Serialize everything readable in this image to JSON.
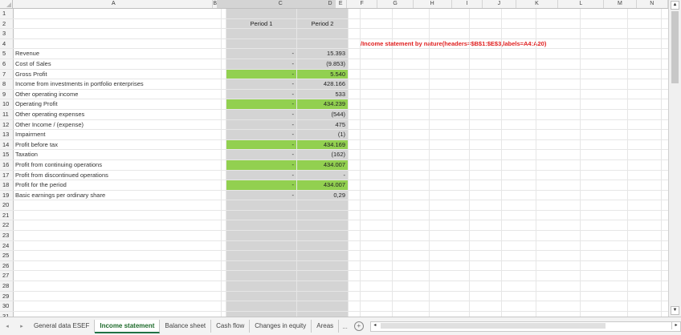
{
  "columns": [
    "A",
    "B",
    "C",
    "D",
    "E",
    "F",
    "G",
    "H",
    "I",
    "J",
    "K",
    "L",
    "M",
    "N"
  ],
  "header_row": {
    "c": "Period 1",
    "d": "Period 2"
  },
  "annotation": "/Income statement by nature(headers=$B$1:$E$3,labels=A4:A20)",
  "rows": [
    {
      "num": "1",
      "a": "",
      "c": "",
      "d": "",
      "green": false
    },
    {
      "num": "2",
      "a": "",
      "c": "Period 1",
      "d": "Period 2",
      "green": false
    },
    {
      "num": "3",
      "a": "",
      "c": "",
      "d": "",
      "green": false
    },
    {
      "num": "4",
      "a": "",
      "c": "",
      "d": "",
      "green": false
    },
    {
      "num": "5",
      "a": "Revenue",
      "c": "-",
      "d": "15.393",
      "green": false
    },
    {
      "num": "6",
      "a": "Cost of Sales",
      "c": "-",
      "d": "(9.853)",
      "green": false
    },
    {
      "num": "7",
      "a": "Gross Profit",
      "c": "-",
      "d": "5.540",
      "green": true
    },
    {
      "num": "8",
      "a": "Income from investments in portfolio enterprises",
      "c": "-",
      "d": "428.166",
      "green": false
    },
    {
      "num": "9",
      "a": "Other operating income",
      "c": "-",
      "d": "533",
      "green": false
    },
    {
      "num": "10",
      "a": "Operating Profit",
      "c": "-",
      "d": "434.239",
      "green": true
    },
    {
      "num": "11",
      "a": "Other operating expenses",
      "c": "-",
      "d": "(544)",
      "green": false
    },
    {
      "num": "12",
      "a": "Other Income / (expense)",
      "c": "-",
      "d": "475",
      "green": false
    },
    {
      "num": "13",
      "a": "Impairment",
      "c": "-",
      "d": "(1)",
      "green": false
    },
    {
      "num": "14",
      "a": "Profit before tax",
      "c": "-",
      "d": "434.169",
      "green": true
    },
    {
      "num": "15",
      "a": "Taxation",
      "c": "-",
      "d": "(162)",
      "green": false
    },
    {
      "num": "16",
      "a": "Profit from continuing operations",
      "c": "-",
      "d": "434.007",
      "green": true
    },
    {
      "num": "17",
      "a": "Profit from discontinued operations",
      "c": "-",
      "d": "-",
      "green": false
    },
    {
      "num": "18",
      "a": "Profit for the period",
      "c": "-",
      "d": "434.007",
      "green": true
    },
    {
      "num": "19",
      "a": "Basic earnings per ordinary share",
      "c": "-",
      "d": "0,29",
      "green": false
    },
    {
      "num": "20",
      "a": "",
      "c": "",
      "d": "",
      "green": false
    },
    {
      "num": "21",
      "a": "",
      "c": "",
      "d": "",
      "green": false
    },
    {
      "num": "22",
      "a": "",
      "c": "",
      "d": "",
      "green": false
    },
    {
      "num": "23",
      "a": "",
      "c": "",
      "d": "",
      "green": false
    },
    {
      "num": "24",
      "a": "",
      "c": "",
      "d": "",
      "green": false
    },
    {
      "num": "25",
      "a": "",
      "c": "",
      "d": "",
      "green": false
    },
    {
      "num": "26",
      "a": "",
      "c": "",
      "d": "",
      "green": false
    },
    {
      "num": "27",
      "a": "",
      "c": "",
      "d": "",
      "green": false
    },
    {
      "num": "28",
      "a": "",
      "c": "",
      "d": "",
      "green": false
    },
    {
      "num": "29",
      "a": "",
      "c": "",
      "d": "",
      "green": false
    },
    {
      "num": "30",
      "a": "",
      "c": "",
      "d": "",
      "green": false
    },
    {
      "num": "31",
      "a": "",
      "c": "",
      "d": "",
      "green": false
    }
  ],
  "tabs": [
    "General data ESEF",
    "Income statement",
    "Balance sheet",
    "Cash flow",
    "Changes in equity",
    "Areas"
  ],
  "active_tab": "Income statement",
  "more_tabs": "...",
  "colors": {
    "highlight": "#92d050",
    "annotation": "#e02020",
    "shaded": "#d4d4d4",
    "active_tab": "#217346"
  }
}
